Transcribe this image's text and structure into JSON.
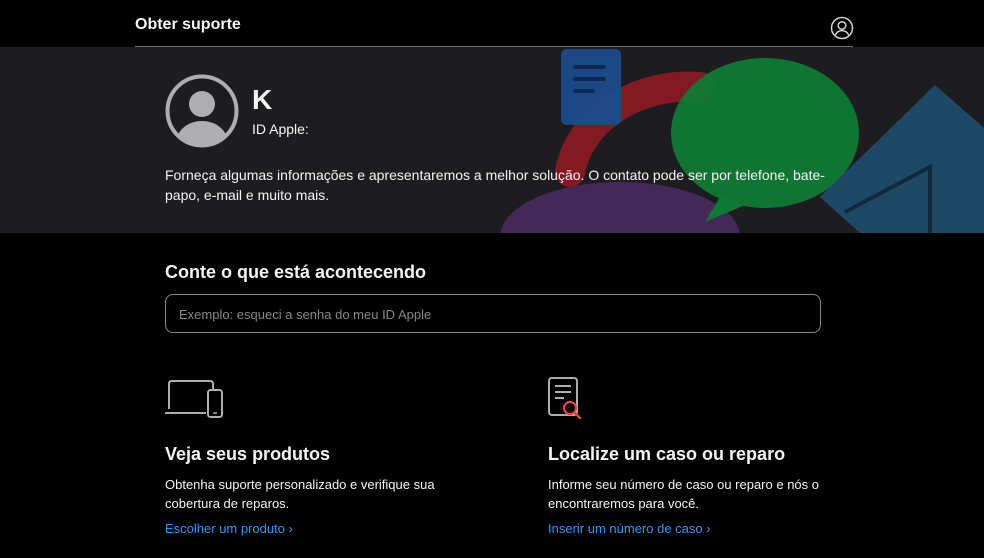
{
  "header": {
    "title": "Obter suporte",
    "account_icon": "person-circle-icon"
  },
  "hero": {
    "initial": "K",
    "apple_id_label": "ID Apple:",
    "description": "Forneça algumas informações e apresentaremos a melhor solução. O contato pode ser por telefone, bate-papo, e-mail e muito mais.",
    "colors": {
      "background": "#1d1d1f",
      "blue": "#1c4b8c",
      "red": "#a11c22",
      "green": "#0f7a35",
      "purple": "#4a2a63",
      "teal": "#1f4c6a"
    }
  },
  "search": {
    "title": "Conte o que está acontecendo",
    "placeholder": "Exemplo: esqueci a senha do meu ID Apple",
    "value": ""
  },
  "cards": {
    "products": {
      "icon": "laptop-phone-icon",
      "title": "Veja seus produtos",
      "description": "Obtenha suporte personalizado e verifique sua cobertura de reparos.",
      "link": "Escolher um produto ›"
    },
    "case": {
      "icon": "document-search-icon",
      "title": "Localize um caso ou reparo",
      "description": "Informe seu número de caso ou reparo e nós o encontraremos para você.",
      "link": "Inserir um número de caso ›"
    }
  },
  "accent_color": "#2997ff"
}
